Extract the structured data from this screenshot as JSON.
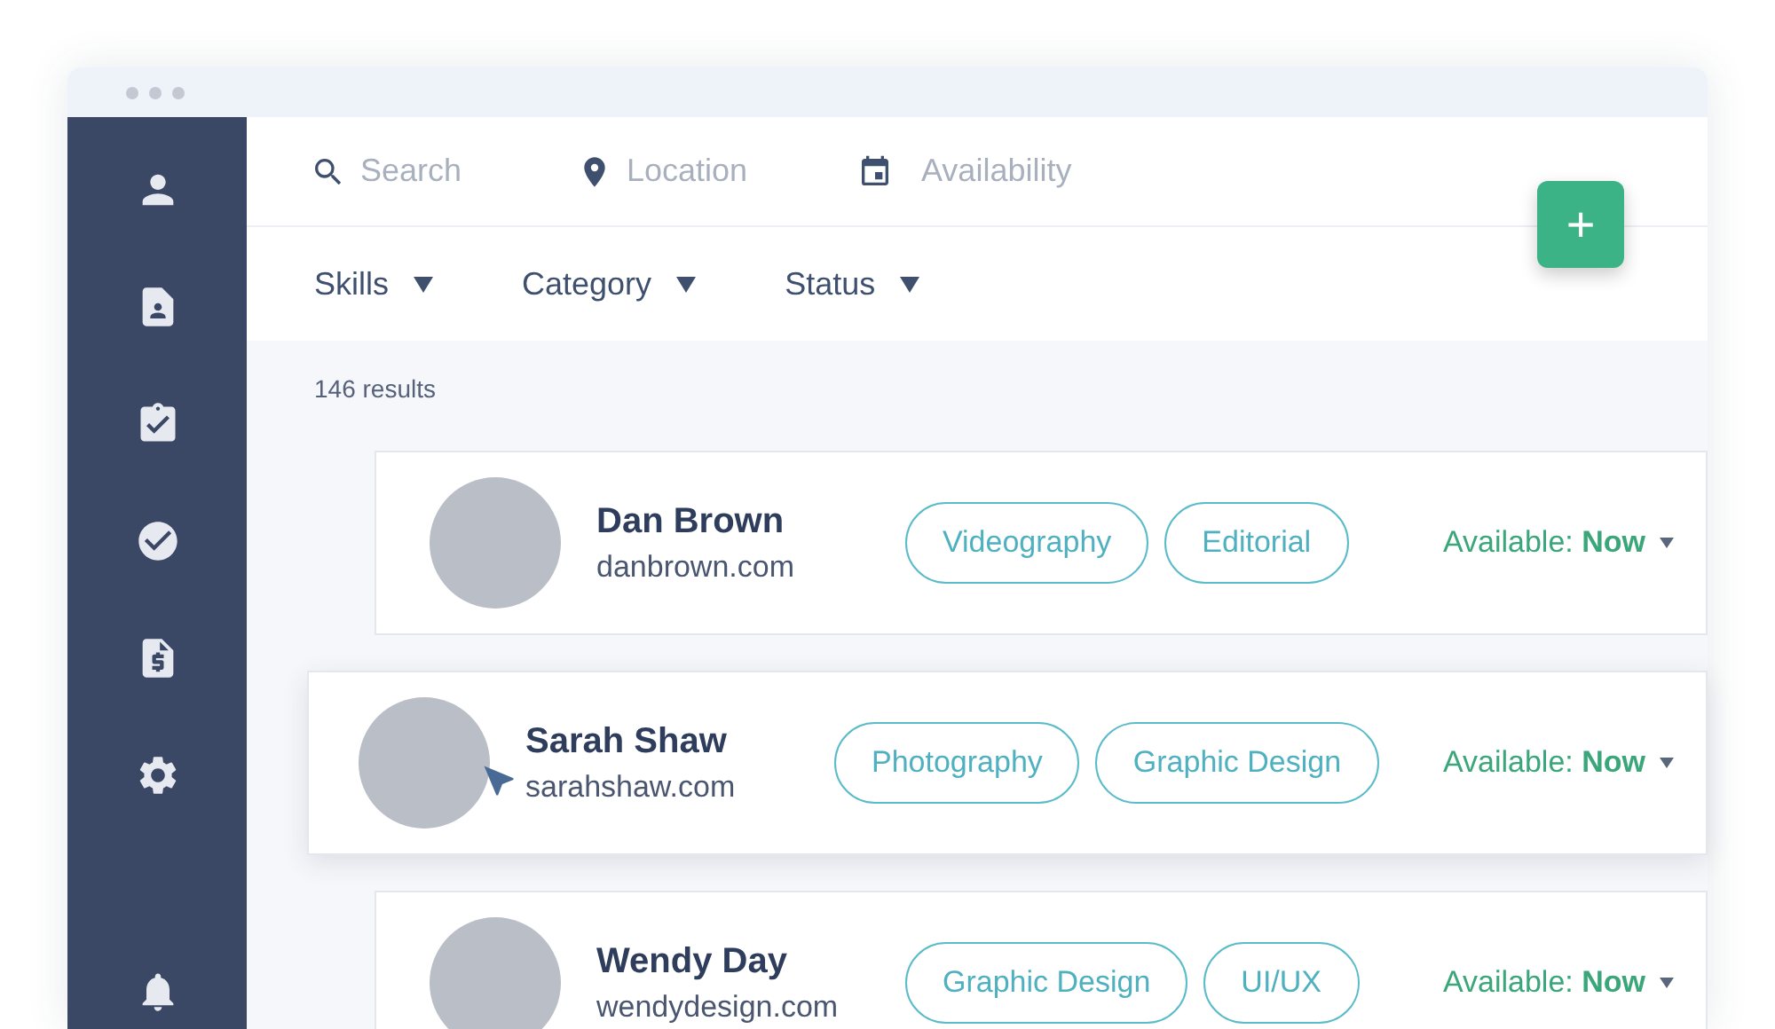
{
  "search_bar": {
    "fields": [
      {
        "placeholder": "Search"
      },
      {
        "placeholder": "Location"
      },
      {
        "placeholder": "Availability"
      }
    ]
  },
  "add_button": {
    "label": "+"
  },
  "filters": [
    {
      "label": "Skills"
    },
    {
      "label": "Category"
    },
    {
      "label": "Status"
    }
  ],
  "results_count": "146 results",
  "people": [
    {
      "name": "Dan Brown",
      "website": "danbrown.com",
      "selected": false,
      "tags": [
        "Videography",
        "Editorial"
      ],
      "availability_label": "Available:",
      "availability": "Now"
    },
    {
      "name": "Sarah Shaw",
      "website": "sarahshaw.com",
      "selected": true,
      "tags": [
        "Photography",
        "Graphic Design"
      ],
      "availability_label": "Available:",
      "availability": "Now"
    },
    {
      "name": "Wendy Day",
      "website": "wendydesign.com",
      "selected": false,
      "tags": [
        "Graphic Design",
        "UI/UX"
      ],
      "availability_label": "Available:",
      "availability": "Now"
    }
  ]
}
